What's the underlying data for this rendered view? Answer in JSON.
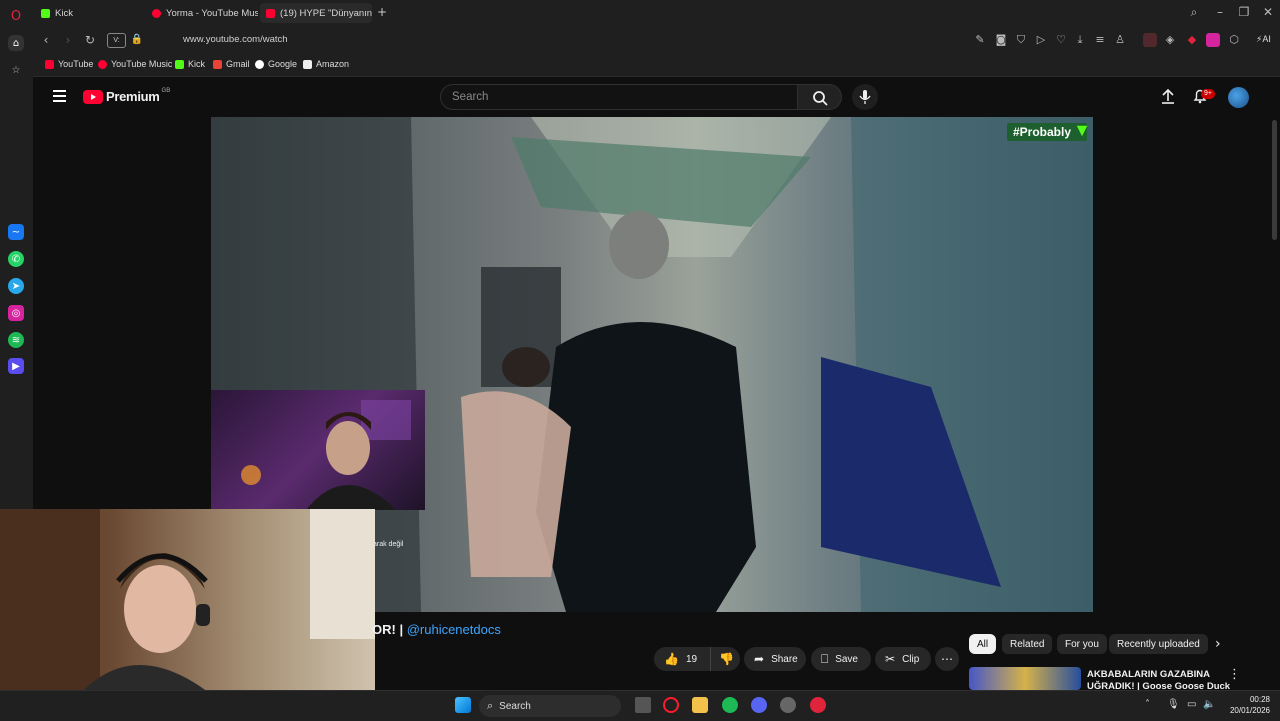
{
  "browser": {
    "tabs": [
      {
        "label": "Kick",
        "favicon": "kick-icon",
        "color": "#53fc18"
      },
      {
        "label": "Yorma - YouTube Mus",
        "favicon": "youtube-music-icon",
        "color": "#ff0033"
      },
      {
        "label": "(19) HYPE \"Dünyanın En H",
        "favicon": "youtube-icon",
        "color": "#ff0033"
      }
    ],
    "address": {
      "url": "www.youtube.com/watch",
      "page_badge": "V:"
    },
    "toolbar_tail_label": "AI",
    "bookmarks": [
      {
        "label": "YouTube",
        "favicon": "youtube-icon"
      },
      {
        "label": "YouTube Music",
        "favicon": "youtube-music-icon"
      },
      {
        "label": "Kick",
        "favicon": "kick-icon"
      },
      {
        "label": "Gmail",
        "favicon": "gmail-icon"
      },
      {
        "label": "Google",
        "favicon": "google-icon"
      },
      {
        "label": "Amazon",
        "favicon": "amazon-icon"
      }
    ]
  },
  "youtube": {
    "logo_text": "Premium",
    "country_code": "GB",
    "search_placeholder": "Search",
    "notifications_badge": "9+"
  },
  "video": {
    "watermark": "#Probably",
    "overlay_caption": "arak değil",
    "title_fragment": "OR! |",
    "mention": "@ruhicenetdocs",
    "like_count": "19",
    "actions": {
      "share": "Share",
      "save": "Save",
      "clip": "Clip"
    }
  },
  "related_chips": [
    "All",
    "Related",
    "For you",
    "Recently uploaded"
  ],
  "related_first": {
    "title_line1": "AKBABALARIN GAZABINA",
    "title_line2": "UĞRADIK! | Goose Goose Duck"
  },
  "taskbar": {
    "search_label": "Search",
    "time": "00:28",
    "date": "20/01/2026"
  },
  "colors": {
    "youtube_red": "#ff0033",
    "link_blue": "#3ea6ff",
    "kick_green": "#53fc18"
  }
}
